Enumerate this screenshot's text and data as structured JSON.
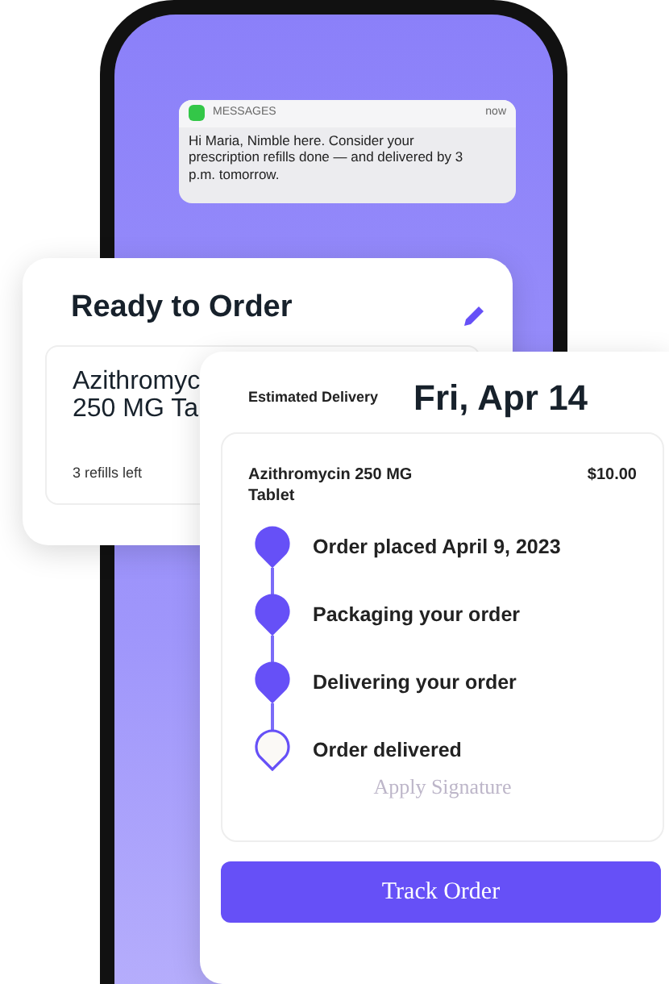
{
  "notification": {
    "app": "MESSAGES",
    "time": "now",
    "message": "Hi Maria, Nimble here. Consider your prescription refills done — and delivered by 3 p.m. tomorrow."
  },
  "ready_card": {
    "title": "Ready to Order",
    "medication_lines": [
      "Azithromyc",
      "250 MG Ta"
    ],
    "refills": "3 refills left"
  },
  "delivery_card": {
    "label": "Estimated Delivery",
    "date": "Fri, Apr 14",
    "item": "Azithromycin 250 MG Tablet",
    "price": "$10.00",
    "steps": [
      {
        "label": "Order placed April 9, 2023",
        "done": true
      },
      {
        "label": "Packaging your order",
        "done": true
      },
      {
        "label": "Delivering your order",
        "done": true
      },
      {
        "label": "Order delivered",
        "done": false
      }
    ],
    "faded_action": "Apply Signature",
    "button": "Track Order"
  }
}
